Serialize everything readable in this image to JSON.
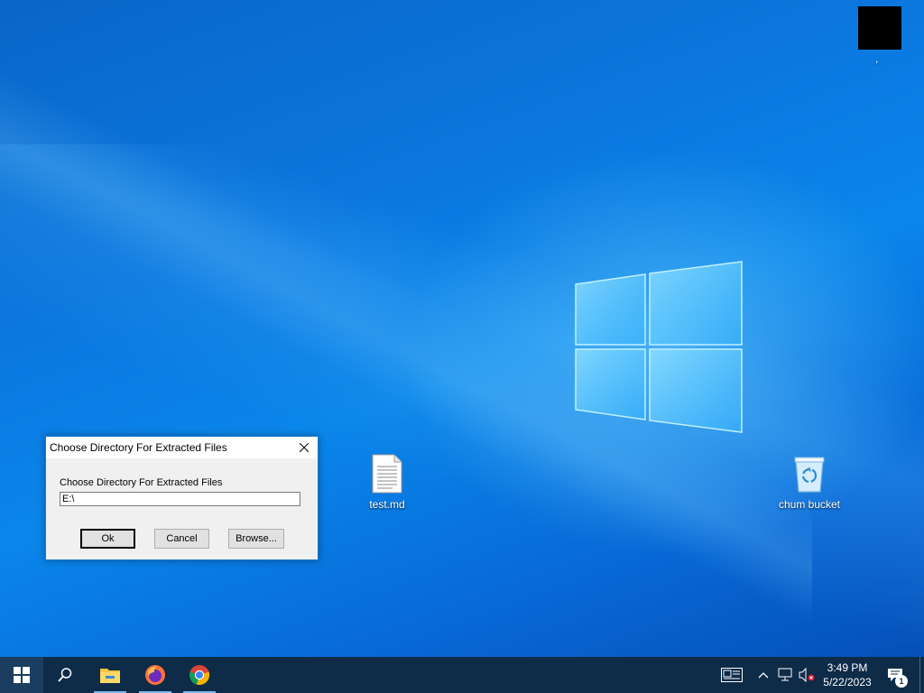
{
  "desktop": {
    "icons": [
      {
        "label": "test.md",
        "icon": "text-file-icon"
      },
      {
        "label": "chum bucket",
        "icon": "recycle-bin-icon"
      }
    ],
    "corner_label": ","
  },
  "dialog": {
    "title": "Choose Directory For Extracted Files",
    "prompt": "Choose Directory For Extracted Files",
    "input_value": "E:\\",
    "ok_label": "Ok",
    "cancel_label": "Cancel",
    "browse_label": "Browse..."
  },
  "taskbar": {
    "apps": [
      {
        "name": "start",
        "icon": "windows-start-icon"
      },
      {
        "name": "search",
        "icon": "search-icon"
      },
      {
        "name": "file-explorer",
        "icon": "folder-icon"
      },
      {
        "name": "firefox",
        "icon": "firefox-icon"
      },
      {
        "name": "chrome",
        "icon": "chrome-icon"
      }
    ],
    "tray": {
      "time": "3:49 PM",
      "date": "5/22/2023",
      "notification_count": "1"
    }
  },
  "colors": {
    "taskbar": "#0e2b48",
    "dialog_border": "#1979ca",
    "wallpaper_accent": "#0b78e0"
  }
}
